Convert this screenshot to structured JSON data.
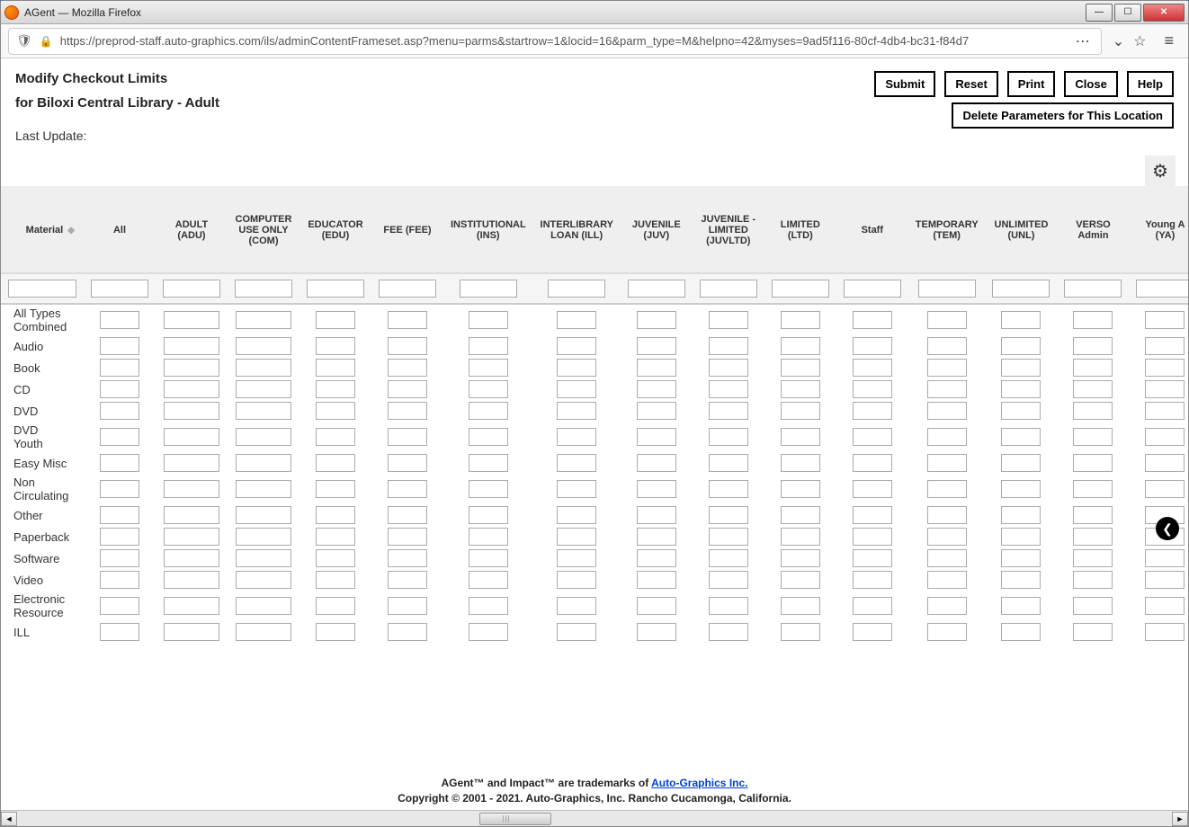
{
  "window": {
    "title": "AGent — Mozilla Firefox"
  },
  "url": "https://preprod-staff.auto-graphics.com/ils/adminContentFrameset.asp?menu=parms&startrow=1&locid=16&parm_type=M&helpno=42&myses=9ad5f116-80cf-4db4-bc31-f84d7",
  "page": {
    "title": "Modify Checkout Limits",
    "subtitle": "for Biloxi Central Library - Adult",
    "lastUpdateLabel": "Last Update:",
    "lastUpdateValue": ""
  },
  "buttons": {
    "submit": "Submit",
    "reset": "Reset",
    "print": "Print",
    "close": "Close",
    "help": "Help",
    "deleteParams": "Delete Parameters for This Location"
  },
  "columns": [
    "Material",
    "All",
    "ADULT (ADU)",
    "COMPUTER USE ONLY (COM)",
    "EDUCATOR (EDU)",
    "FEE (FEE)",
    "INSTITUTIONAL (INS)",
    "INTERLIBRARY LOAN (ILL)",
    "JUVENILE (JUV)",
    "JUVENILE - LIMITED (JUVLTD)",
    "LIMITED (LTD)",
    "Staff",
    "TEMPORARY (TEM)",
    "UNLIMITED (UNL)",
    "VERSO Admin",
    "Young A (YA)"
  ],
  "rows": [
    "All Types Combined",
    "Audio",
    "Book",
    "CD",
    "DVD",
    "DVD Youth",
    "Easy Misc",
    "Non Circulating",
    "Other",
    "Paperback",
    "Software",
    "Video",
    "Electronic Resource",
    "ILL"
  ],
  "footer": {
    "line1_pre": "AGent™ and Impact™ are trademarks of ",
    "line1_link": "Auto-Graphics Inc.",
    "line2": "Copyright © 2001 - 2021. Auto-Graphics, Inc. Rancho Cucamonga, California."
  }
}
